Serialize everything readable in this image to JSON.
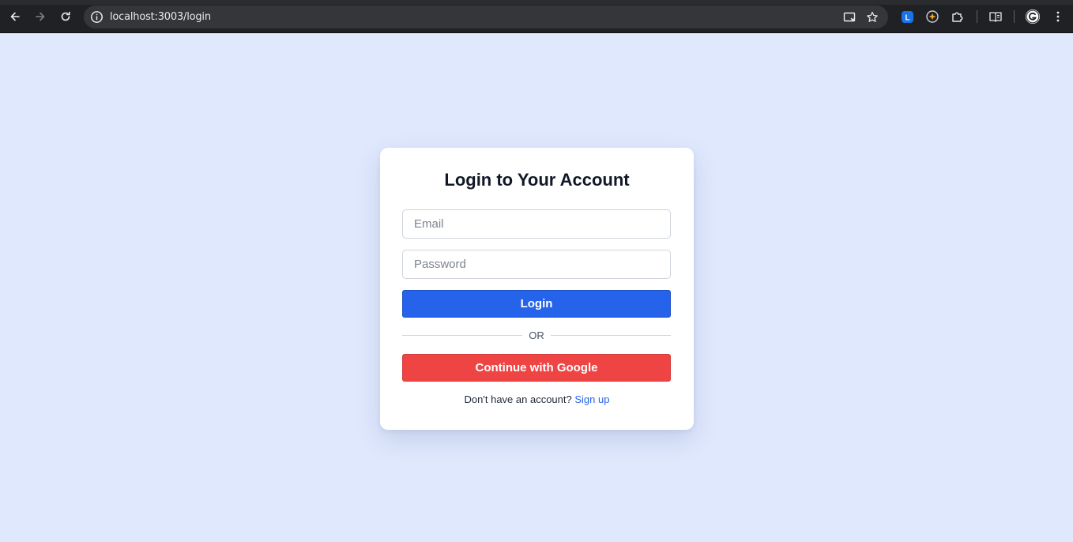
{
  "browser": {
    "url": "localhost:3003/login"
  },
  "login": {
    "title": "Login to Your Account",
    "email_placeholder": "Email",
    "password_placeholder": "Password",
    "login_label": "Login",
    "divider_text": "OR",
    "google_label": "Continue with Google",
    "signup_prompt": "Don't have an account?",
    "signup_link": "Sign up"
  },
  "colors": {
    "background": "#dfe8fd",
    "primary": "#2563eb",
    "google": "#ef4444"
  },
  "icons": [
    "back-arrow-icon",
    "forward-arrow-icon",
    "reload-icon",
    "site-info-icon",
    "install-app-icon",
    "bookmark-star-icon",
    "extension-icon",
    "puzzle-icon",
    "reading-list-icon",
    "profile-avatar-icon",
    "more-menu-icon"
  ]
}
